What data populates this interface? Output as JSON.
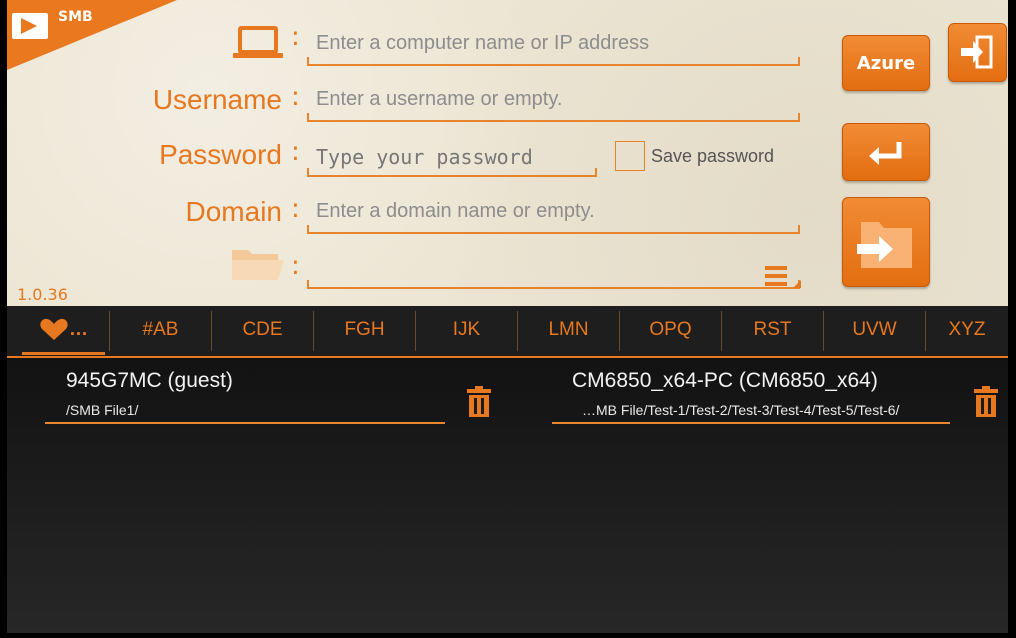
{
  "app": {
    "corner_label": "SMB",
    "version": "1.0.36"
  },
  "form": {
    "computer_placeholder": "Enter a computer name or IP address",
    "username_label": "Username",
    "username_placeholder": "Enter a username or empty.",
    "password_label": "Password",
    "password_placeholder": "Type your password",
    "save_password_label": "Save password",
    "domain_label": "Domain",
    "domain_placeholder": "Enter a domain name or empty.",
    "colon": ":"
  },
  "buttons": {
    "azure_label": "Azure"
  },
  "tabs": [
    "#AB",
    "CDE",
    "FGH",
    "IJK",
    "LMN",
    "OPQ",
    "RST",
    "UVW",
    "XYZ"
  ],
  "favorites_tab_label": "…",
  "entries": [
    {
      "title": "945G7MC (guest)",
      "path": "/SMB File1/"
    },
    {
      "title": "CM6850_x64-PC (CM6850_x64)",
      "path": "…MB File/Test-1/Test-2/Test-3/Test-4/Test-5/Test-6/"
    }
  ],
  "colors": {
    "accent": "#e7781f",
    "background_top": "#ece5d3",
    "background_bottom": "#1a1a1a"
  }
}
